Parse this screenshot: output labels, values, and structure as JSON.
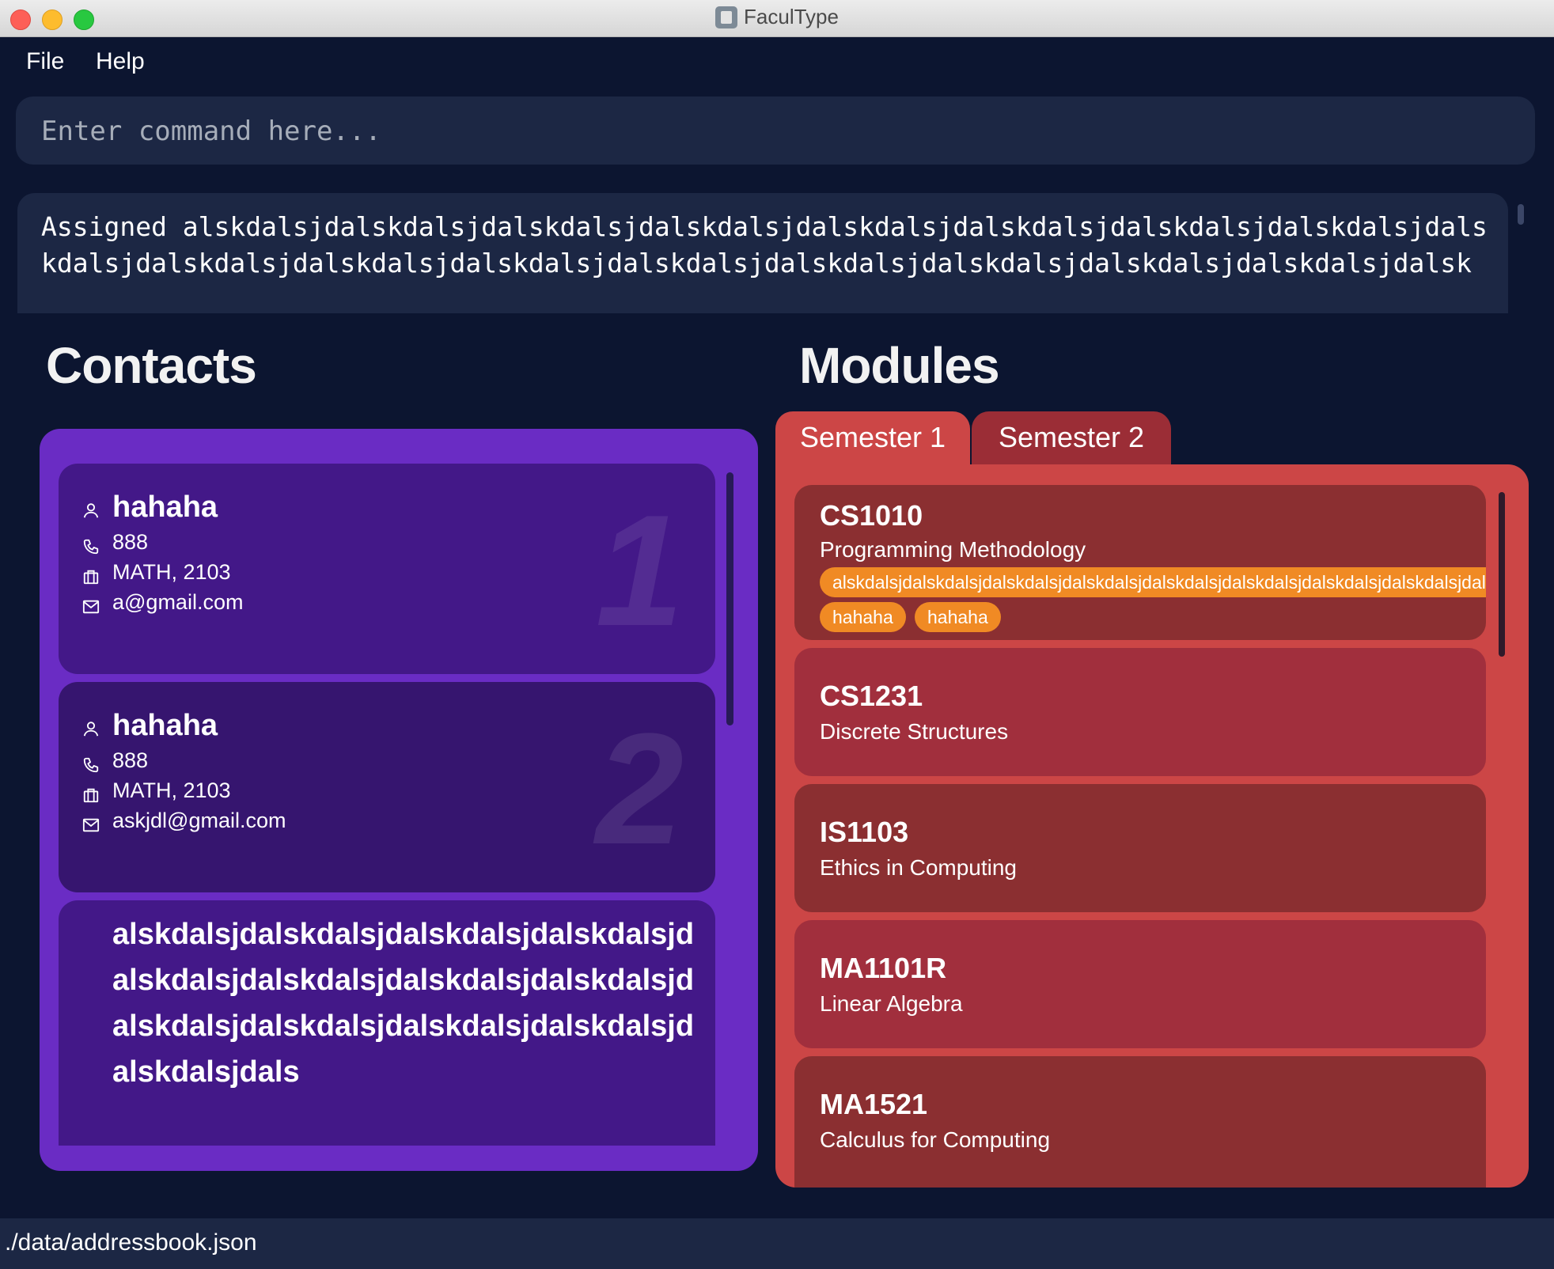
{
  "window": {
    "title": "FaculType"
  },
  "menu": {
    "items": [
      "File",
      "Help"
    ]
  },
  "command": {
    "placeholder": "Enter command here...",
    "value": ""
  },
  "result": {
    "text": "Assigned alskdalsjdalskdalsjdalskdalsjdalskdalsjdalskdalsjdalskdalsjdalskdalsjdalskdalsjdalskdalsjdalskdalsjdalskdalsjdalskdalsjdalskdalsjdalskdalsjdalskdalsjdalskdalsjdalskdalsjdalsk"
  },
  "contacts": {
    "title": "Contacts",
    "cards": [
      {
        "index": "1",
        "name": "hahaha",
        "phone": "888",
        "module": "MATH, 2103",
        "email": "a@gmail.com"
      },
      {
        "index": "2",
        "name": "hahaha",
        "phone": "888",
        "module": "MATH, 2103",
        "email": "askjdl@gmail.com"
      },
      {
        "name": "alskdalsjdalskdalsjdalskdalsjdalskdalsjdalskdalsjdalskdalsjdalskdalsjdalskdalsjdalskdalsjdalskdalsjdalskdalsjdalskdalsjdalskdalsjdals"
      }
    ]
  },
  "modules": {
    "title": "Modules",
    "tabs": [
      "Semester 1",
      "Semester 2"
    ],
    "active_tab": "Semester 1",
    "items": [
      {
        "code": "CS1010",
        "title": "Programming Methodology",
        "tags": [
          "alskdalsjdalskdalsjdalskdalsjdalskdalsjdalskdalsjdalskdalsjdalskdalsjdalskdalsjdalsk",
          "hahaha",
          "hahaha"
        ]
      },
      {
        "code": "CS1231",
        "title": "Discrete Structures"
      },
      {
        "code": "IS1103",
        "title": "Ethics in Computing"
      },
      {
        "code": "MA1101R",
        "title": "Linear Algebra"
      },
      {
        "code": "MA1521",
        "title": "Calculus for Computing"
      }
    ]
  },
  "status": {
    "path": "./data/addressbook.json"
  },
  "colors": {
    "background": "#0c1530",
    "panel_dark": "#1c2744",
    "contacts_panel": "#6a2cc4",
    "contact_card": "#431888",
    "modules_panel": "#cc4646",
    "module_card_dark": "#8b2f31",
    "module_card_light": "#a12f3d",
    "tag": "#f08a24"
  },
  "icons": {
    "name": "person-icon",
    "phone": "phone-icon",
    "module": "briefcase-icon",
    "email": "mail-icon"
  }
}
